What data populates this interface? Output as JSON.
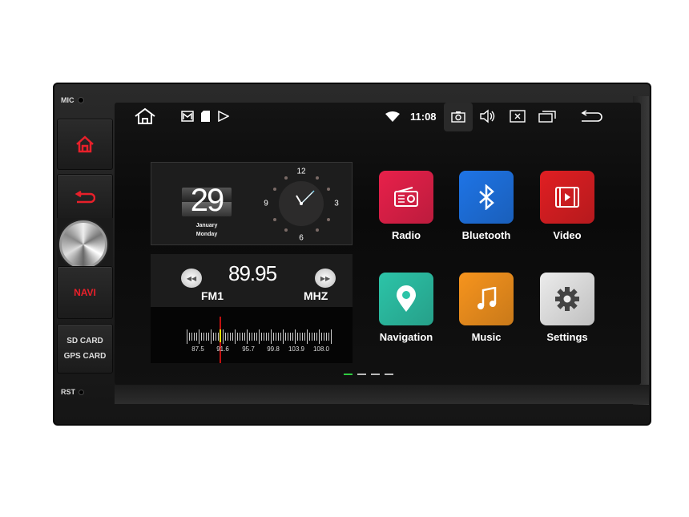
{
  "hardware": {
    "mic_label": "MIC",
    "navi_label": "NAVI",
    "sd_label": "SD CARD",
    "gps_label": "GPS CARD",
    "rst_label": "RST"
  },
  "status_bar": {
    "time": "11:08",
    "icons": [
      "home-icon",
      "gallery-icon",
      "sd-card-icon",
      "play-store-icon",
      "wifi-icon",
      "camera-icon",
      "volume-icon",
      "close-window-icon",
      "recent-apps-icon",
      "back-icon"
    ]
  },
  "clock_widget": {
    "day": "29",
    "month": "January",
    "weekday": "Monday",
    "dial": [
      "12",
      "3",
      "6",
      "9"
    ],
    "time": "11:08"
  },
  "radio_widget": {
    "frequency": "89.95",
    "band": "FM1",
    "unit": "MHZ",
    "scale": [
      "87.5",
      "91.6",
      "95.7",
      "99.8",
      "103.9",
      "108.0"
    ]
  },
  "apps": [
    {
      "label": "Radio",
      "color": "#e8204a"
    },
    {
      "label": "Bluetooth",
      "color": "#1e74e6"
    },
    {
      "label": "Video",
      "color": "#e01e22"
    },
    {
      "label": "Navigation",
      "color": "#2cc4a8"
    },
    {
      "label": "Music",
      "color": "#f7941d"
    },
    {
      "label": "Settings",
      "color": "#ececec"
    }
  ],
  "pager": {
    "pages": 4,
    "active": 1
  }
}
